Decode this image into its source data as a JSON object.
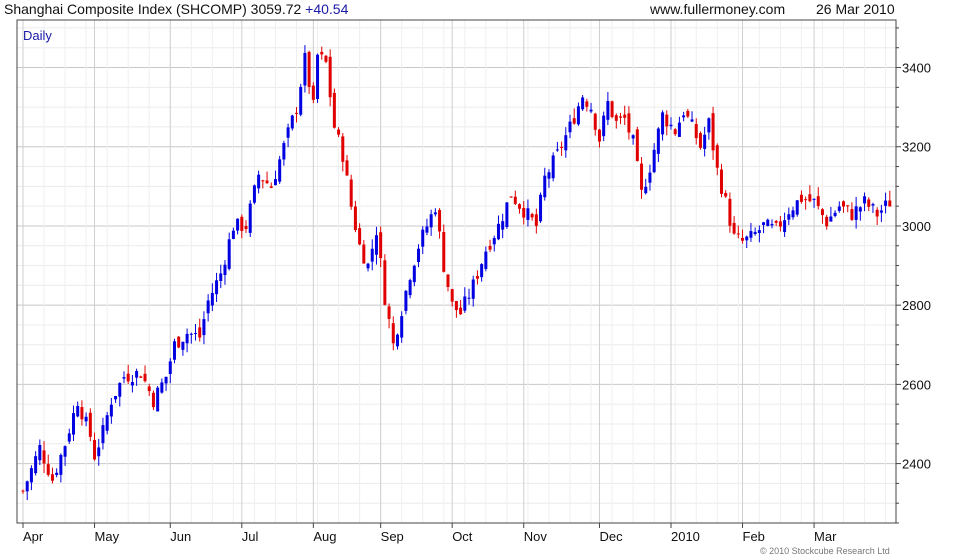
{
  "header": {
    "index_label": "Shanghai Composite Index (SHCOMP)",
    "last_value": "3059.72",
    "change": "+40.54",
    "website": "www.fullermoney.com",
    "date": "26 Mar 2010"
  },
  "footer": {
    "copyright": "© 2010 Stockcube Research Ltd"
  },
  "colors": {
    "up": "#0000e0",
    "down": "#e00000",
    "grid": "#d9d9d9",
    "frame": "#444444",
    "label": "#1a1aa6"
  },
  "chart_data": {
    "type": "candlestick",
    "period_label": "Daily",
    "grid": true,
    "ylim": [
      2250,
      3520
    ],
    "y_ticks": [
      2400,
      2600,
      2800,
      3000,
      3200,
      3400
    ],
    "x_ticks": [
      {
        "label": "Apr",
        "i": 0
      },
      {
        "label": "May",
        "i": 17
      },
      {
        "label": "Jun",
        "i": 35
      },
      {
        "label": "Jul",
        "i": 52
      },
      {
        "label": "Aug",
        "i": 69
      },
      {
        "label": "Sep",
        "i": 85
      },
      {
        "label": "Oct",
        "i": 102
      },
      {
        "label": "Nov",
        "i": 119
      },
      {
        "label": "Dec",
        "i": 137
      },
      {
        "label": "2010",
        "i": 154
      },
      {
        "label": "Feb",
        "i": 171
      },
      {
        "label": "Mar",
        "i": 188
      }
    ],
    "x_count": 207,
    "series": [
      {
        "name": "close",
        "knots": [
          [
            0,
            2330
          ],
          [
            4,
            2440
          ],
          [
            7,
            2360
          ],
          [
            10,
            2450
          ],
          [
            13,
            2560
          ],
          [
            16,
            2470
          ],
          [
            17,
            2420
          ],
          [
            19,
            2480
          ],
          [
            21,
            2560
          ],
          [
            24,
            2620
          ],
          [
            28,
            2630
          ],
          [
            31,
            2560
          ],
          [
            34,
            2620
          ],
          [
            36,
            2700
          ],
          [
            39,
            2730
          ],
          [
            42,
            2720
          ],
          [
            44,
            2810
          ],
          [
            47,
            2880
          ],
          [
            50,
            3000
          ],
          [
            53,
            3000
          ],
          [
            56,
            3130
          ],
          [
            59,
            3100
          ],
          [
            62,
            3200
          ],
          [
            65,
            3300
          ],
          [
            67,
            3420
          ],
          [
            69,
            3300
          ],
          [
            70,
            3430
          ],
          [
            72,
            3410
          ],
          [
            74,
            3250
          ],
          [
            76,
            3180
          ],
          [
            78,
            3050
          ],
          [
            80,
            2950
          ],
          [
            82,
            2900
          ],
          [
            84,
            2990
          ],
          [
            86,
            2820
          ],
          [
            88,
            2700
          ],
          [
            90,
            2790
          ],
          [
            92,
            2880
          ],
          [
            94,
            2950
          ],
          [
            96,
            3000
          ],
          [
            98,
            3050
          ],
          [
            100,
            2900
          ],
          [
            102,
            2800
          ],
          [
            104,
            2780
          ],
          [
            107,
            2850
          ],
          [
            110,
            2940
          ],
          [
            113,
            3000
          ],
          [
            116,
            3080
          ],
          [
            119,
            3040
          ],
          [
            122,
            3000
          ],
          [
            124,
            3120
          ],
          [
            127,
            3180
          ],
          [
            130,
            3250
          ],
          [
            133,
            3330
          ],
          [
            135,
            3300
          ],
          [
            137,
            3220
          ],
          [
            139,
            3310
          ],
          [
            141,
            3260
          ],
          [
            143,
            3270
          ],
          [
            145,
            3210
          ],
          [
            147,
            3080
          ],
          [
            149,
            3150
          ],
          [
            152,
            3280
          ],
          [
            155,
            3240
          ],
          [
            157,
            3290
          ],
          [
            159,
            3250
          ],
          [
            161,
            3200
          ],
          [
            163,
            3260
          ],
          [
            165,
            3140
          ],
          [
            167,
            3060
          ],
          [
            169,
            2970
          ],
          [
            171,
            2960
          ],
          [
            173,
            2970
          ],
          [
            176,
            3000
          ],
          [
            179,
            2990
          ],
          [
            182,
            3040
          ],
          [
            185,
            3070
          ],
          [
            188,
            3060
          ],
          [
            191,
            3010
          ],
          [
            194,
            3050
          ],
          [
            197,
            3030
          ],
          [
            200,
            3060
          ],
          [
            203,
            3030
          ],
          [
            206,
            3060
          ]
        ]
      }
    ]
  }
}
